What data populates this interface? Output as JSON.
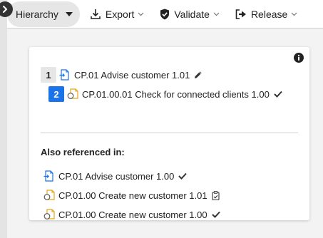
{
  "toolbar": {
    "hierarchy_label": "Hierarchy",
    "export_label": "Export",
    "validate_label": "Validate",
    "release_label": "Release"
  },
  "hierarchy": [
    {
      "level": "1",
      "text": "CP.01 Advise customer 1.01",
      "type": "process",
      "status": "pencil-icon"
    },
    {
      "level": "2",
      "text": "CP.01.00.01 Check for connected clients 1.00",
      "type": "subprocess",
      "status": "check-icon"
    }
  ],
  "referenced": {
    "title": "Also referenced in:",
    "items": [
      {
        "text": "CP.01 Advise customer 1.00",
        "type": "process",
        "status": "check-icon"
      },
      {
        "text": "CP.01.00 Create new customer 1.01",
        "type": "subprocess",
        "status": "clipboard-icon"
      },
      {
        "text": "CP.01.00 Create new customer 1.00",
        "type": "subprocess",
        "status": "check-icon"
      }
    ]
  },
  "colors": {
    "level_2_badge": "#1a73e8",
    "process_icon": "#1a73e8",
    "subprocess_icon": "#e8a317"
  }
}
